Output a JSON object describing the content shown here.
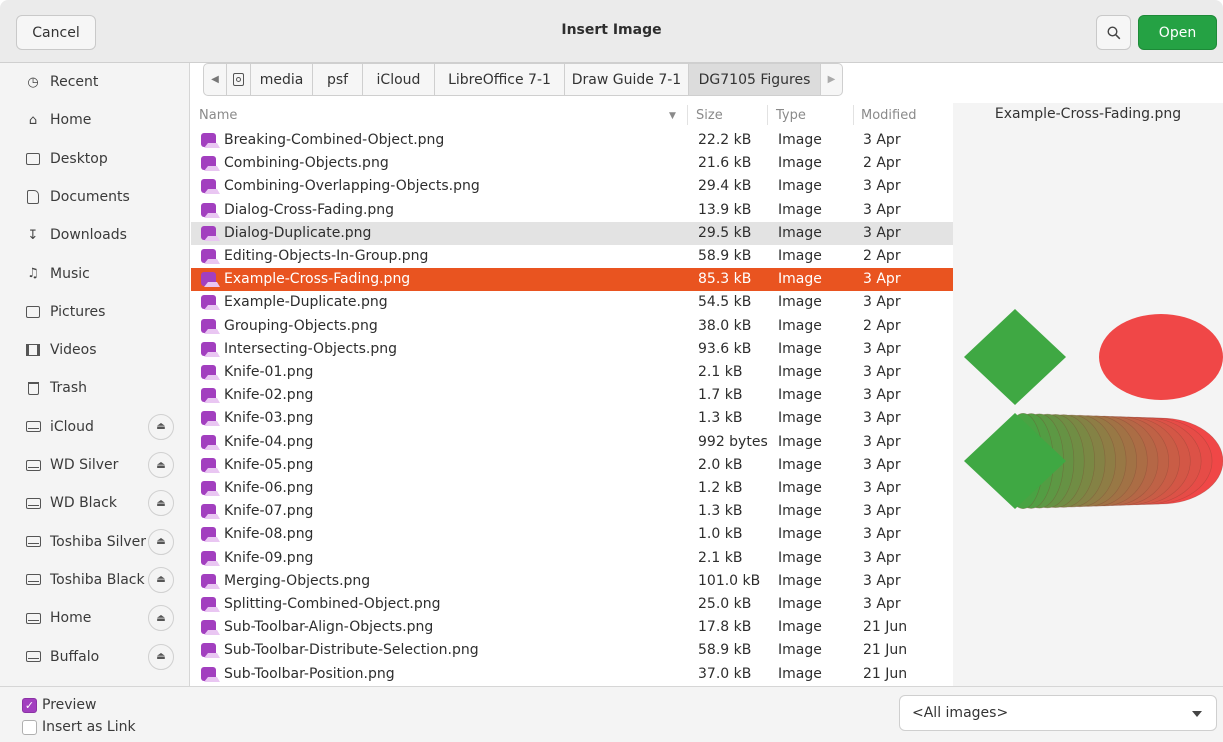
{
  "header": {
    "cancel_label": "Cancel",
    "title": "Insert Image",
    "open_label": "Open"
  },
  "sidebar": {
    "items": [
      {
        "label": "Recent",
        "icon": "clock-icon",
        "eject": false
      },
      {
        "label": "Home",
        "icon": "home-icon",
        "eject": false
      },
      {
        "label": "Desktop",
        "icon": "desktop-icon",
        "eject": false
      },
      {
        "label": "Documents",
        "icon": "document-icon",
        "eject": false
      },
      {
        "label": "Downloads",
        "icon": "download-icon",
        "eject": false
      },
      {
        "label": "Music",
        "icon": "music-icon",
        "eject": false
      },
      {
        "label": "Pictures",
        "icon": "picture-icon",
        "eject": false
      },
      {
        "label": "Videos",
        "icon": "video-icon",
        "eject": false
      },
      {
        "label": "Trash",
        "icon": "trash-icon",
        "eject": false
      },
      {
        "label": "iCloud",
        "icon": "drive-icon",
        "eject": true
      },
      {
        "label": "WD Silver",
        "icon": "drive-icon",
        "eject": true
      },
      {
        "label": "WD Black",
        "icon": "drive-icon",
        "eject": true
      },
      {
        "label": "Toshiba Silver",
        "icon": "drive-icon",
        "eject": true
      },
      {
        "label": "Toshiba Black",
        "icon": "drive-icon",
        "eject": true
      },
      {
        "label": "Home",
        "icon": "drive-icon",
        "eject": true
      },
      {
        "label": "Buffalo",
        "icon": "drive-icon",
        "eject": true
      }
    ]
  },
  "pathbar": {
    "crumbs": [
      "media",
      "psf",
      "iCloud",
      "LibreOffice 7-1",
      "Draw Guide 7-1",
      "DG7105 Figures"
    ]
  },
  "columns": {
    "name": "Name",
    "size": "Size",
    "type": "Type",
    "modified": "Modified"
  },
  "files": [
    {
      "name": "Breaking-Combined-Object.png",
      "size": "22.2 kB",
      "type": "Image",
      "modified": "3 Apr"
    },
    {
      "name": "Combining-Objects.png",
      "size": "21.6 kB",
      "type": "Image",
      "modified": "2 Apr"
    },
    {
      "name": "Combining-Overlapping-Objects.png",
      "size": "29.4 kB",
      "type": "Image",
      "modified": "3 Apr"
    },
    {
      "name": "Dialog-Cross-Fading.png",
      "size": "13.9 kB",
      "type": "Image",
      "modified": "3 Apr"
    },
    {
      "name": "Dialog-Duplicate.png",
      "size": "29.5 kB",
      "type": "Image",
      "modified": "3 Apr"
    },
    {
      "name": "Editing-Objects-In-Group.png",
      "size": "58.9 kB",
      "type": "Image",
      "modified": "2 Apr"
    },
    {
      "name": "Example-Cross-Fading.png",
      "size": "85.3 kB",
      "type": "Image",
      "modified": "3 Apr"
    },
    {
      "name": "Example-Duplicate.png",
      "size": "54.5 kB",
      "type": "Image",
      "modified": "3 Apr"
    },
    {
      "name": "Grouping-Objects.png",
      "size": "38.0 kB",
      "type": "Image",
      "modified": "2 Apr"
    },
    {
      "name": "Intersecting-Objects.png",
      "size": "93.6 kB",
      "type": "Image",
      "modified": "3 Apr"
    },
    {
      "name": "Knife-01.png",
      "size": "2.1 kB",
      "type": "Image",
      "modified": "3 Apr"
    },
    {
      "name": "Knife-02.png",
      "size": "1.7 kB",
      "type": "Image",
      "modified": "3 Apr"
    },
    {
      "name": "Knife-03.png",
      "size": "1.3 kB",
      "type": "Image",
      "modified": "3 Apr"
    },
    {
      "name": "Knife-04.png",
      "size": "992 bytes",
      "type": "Image",
      "modified": "3 Apr"
    },
    {
      "name": "Knife-05.png",
      "size": "2.0 kB",
      "type": "Image",
      "modified": "3 Apr"
    },
    {
      "name": "Knife-06.png",
      "size": "1.2 kB",
      "type": "Image",
      "modified": "3 Apr"
    },
    {
      "name": "Knife-07.png",
      "size": "1.3 kB",
      "type": "Image",
      "modified": "3 Apr"
    },
    {
      "name": "Knife-08.png",
      "size": "1.0 kB",
      "type": "Image",
      "modified": "3 Apr"
    },
    {
      "name": "Knife-09.png",
      "size": "2.1 kB",
      "type": "Image",
      "modified": "3 Apr"
    },
    {
      "name": "Merging-Objects.png",
      "size": "101.0 kB",
      "type": "Image",
      "modified": "3 Apr"
    },
    {
      "name": "Splitting-Combined-Object.png",
      "size": "25.0 kB",
      "type": "Image",
      "modified": "3 Apr"
    },
    {
      "name": "Sub-Toolbar-Align-Objects.png",
      "size": "17.8 kB",
      "type": "Image",
      "modified": "21 Jun"
    },
    {
      "name": "Sub-Toolbar-Distribute-Selection.png",
      "size": "58.9 kB",
      "type": "Image",
      "modified": "21 Jun"
    },
    {
      "name": "Sub-Toolbar-Position.png",
      "size": "37.0 kB",
      "type": "Image",
      "modified": "21 Jun"
    }
  ],
  "selected_index": 6,
  "hover_index": 4,
  "preview": {
    "filename": "Example-Cross-Fading.png",
    "colors": {
      "green": "#3fa843",
      "red": "#f04747"
    }
  },
  "footer": {
    "preview_label": "Preview",
    "preview_checked": true,
    "insert_link_label": "Insert as Link",
    "insert_link_checked": false,
    "filter_value": "<All images>"
  },
  "colors": {
    "accent": "#e95420",
    "open_button": "#25a244",
    "file_icon": "#a23fbf"
  }
}
